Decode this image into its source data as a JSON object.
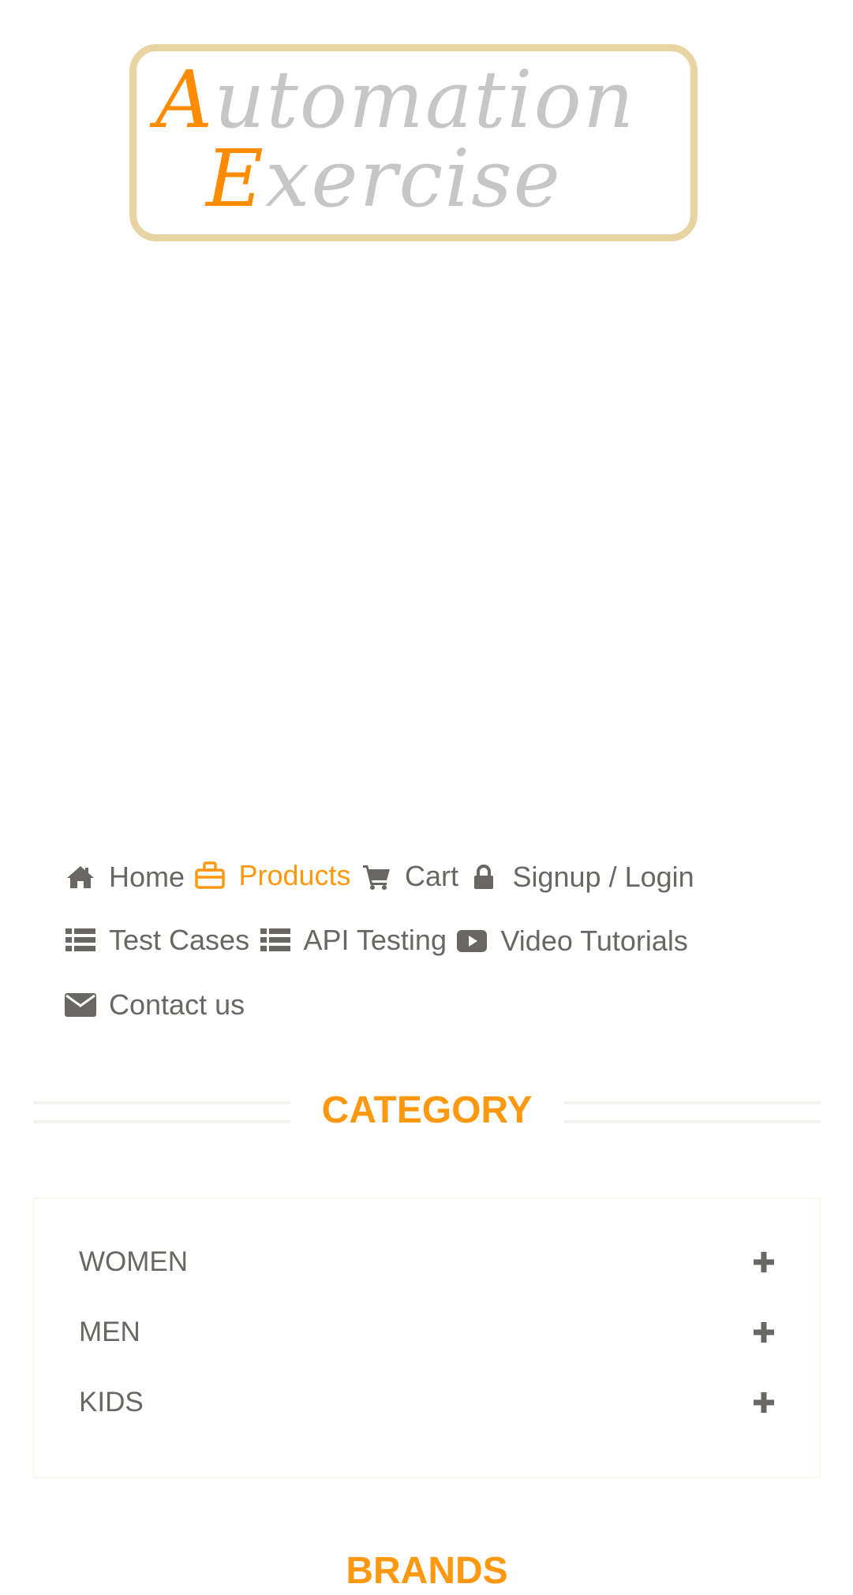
{
  "logo": {
    "alt": "Automation Exercise",
    "line1_initial": "A",
    "line1_rest": "utomation",
    "line2_initial": "E",
    "line2_rest": "xercise"
  },
  "nav": {
    "items": [
      {
        "label": "Home",
        "icon": "home-icon",
        "active": false
      },
      {
        "label": "Products",
        "icon": "products-icon",
        "active": true
      },
      {
        "label": "Cart",
        "icon": "cart-icon",
        "active": false
      },
      {
        "label": "Signup / Login",
        "icon": "lock-icon",
        "active": false
      },
      {
        "label": "Test Cases",
        "icon": "list-icon",
        "active": false
      },
      {
        "label": "API Testing",
        "icon": "list-icon",
        "active": false
      },
      {
        "label": "Video Tutorials",
        "icon": "youtube-play-icon",
        "active": false
      },
      {
        "label": "Contact us",
        "icon": "envelope-icon",
        "active": false
      }
    ]
  },
  "category": {
    "title": "CATEGORY",
    "items": [
      {
        "label": "WOMEN",
        "icon": "plus-icon"
      },
      {
        "label": "MEN",
        "icon": "plus-icon"
      },
      {
        "label": "KIDS",
        "icon": "plus-icon"
      }
    ]
  },
  "brands": {
    "title": "BRANDS"
  },
  "colors": {
    "accent": "#fe980f",
    "text": "#696763",
    "logo_border": "#e8d3a3",
    "logo_gray": "#c6c6c6",
    "logo_orange": "#ff8c00"
  }
}
